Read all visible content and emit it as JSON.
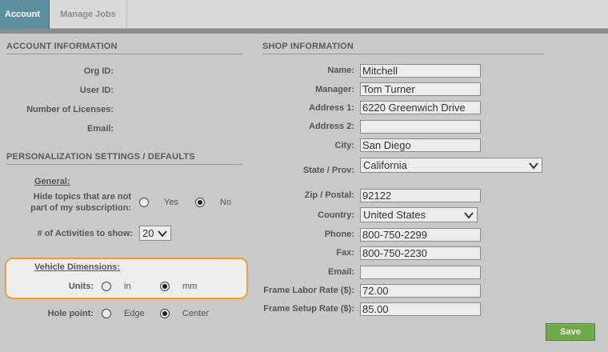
{
  "tabs": {
    "account": "Account",
    "manage_jobs": "Manage Jobs"
  },
  "account_info": {
    "heading": "ACCOUNT INFORMATION",
    "org_id_label": "Org ID:",
    "user_id_label": "User ID:",
    "licenses_label": "Number of Licenses:",
    "email_label": "Email:"
  },
  "personalization": {
    "heading": "PERSONALIZATION SETTINGS / DEFAULTS",
    "general_label": "General:",
    "hide_topics_line1": "Hide topics that are not",
    "hide_topics_line2": "part of my subscription:",
    "hide_topics_options": {
      "yes": "Yes",
      "no": "No",
      "selected": "No"
    },
    "activities_label": "# of Activities to show:",
    "activities_value": "20",
    "vehicle_dimensions_label": "Vehicle Dimensions:",
    "units_label": "Units:",
    "units_options": {
      "in": "in",
      "mm": "mm",
      "selected": "mm"
    },
    "hole_point_label": "Hole point:",
    "hole_point_options": {
      "edge": "Edge",
      "center": "Center",
      "selected": "Center"
    }
  },
  "shop_info": {
    "heading": "SHOP INFORMATION",
    "name_label": "Name:",
    "name_value": "Mitchell",
    "manager_label": "Manager:",
    "manager_value": "Tom Turner",
    "address1_label": "Address 1:",
    "address1_value": "6220 Greenwich Drive",
    "address2_label": "Address 2:",
    "address2_value": "",
    "city_label": "City:",
    "city_value": "San Diego",
    "state_label": "State / Prov:",
    "state_value": "California",
    "zip_label": "Zip / Postal:",
    "zip_value": "92122",
    "country_label": "Country:",
    "country_value": "United States",
    "phone_label": "Phone:",
    "phone_value": "800-750-2299",
    "fax_label": "Fax:",
    "fax_value": "800-750-2230",
    "email_label": "Email:",
    "email_value": "",
    "labor_rate_label": "Frame Labor Rate ($):",
    "labor_rate_value": "72.00",
    "setup_rate_label": "Frame Setup Rate ($):",
    "setup_rate_value": "85.00"
  },
  "actions": {
    "save": "Save"
  },
  "colors": {
    "accent_tab": "#5b8fa0",
    "save_green": "#6fa94b",
    "highlight_border": "#e6a23c"
  }
}
